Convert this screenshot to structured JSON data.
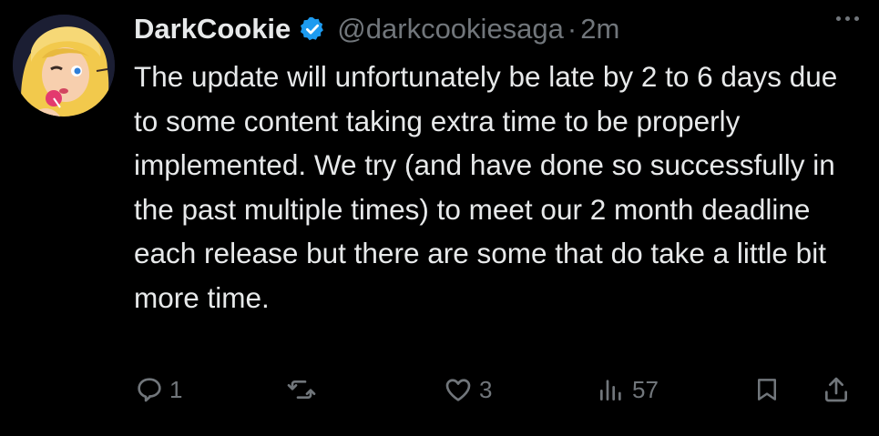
{
  "author": {
    "display_name": "DarkCookie",
    "handle": "@darkcookiesaga",
    "separator": "·",
    "time": "2m",
    "verified": true
  },
  "tweet_text": "The update will unfortunately be late by 2 to 6 days due to some content taking extra time to be properly implemented. We try (and have done so successfully in the past multiple times) to meet our 2 month deadline each release but there are some that do take a little bit more time.",
  "metrics": {
    "replies": "1",
    "retweets": "",
    "likes": "3",
    "views": "57"
  },
  "icons": [
    "more-options-icon",
    "verified-badge-icon",
    "reply-icon",
    "retweet-icon",
    "like-icon",
    "views-icon",
    "bookmark-icon",
    "share-icon"
  ],
  "colors": {
    "background": "#000000",
    "text": "#e7e9ea",
    "muted": "#71767b",
    "verified": "#1d9bf0"
  }
}
